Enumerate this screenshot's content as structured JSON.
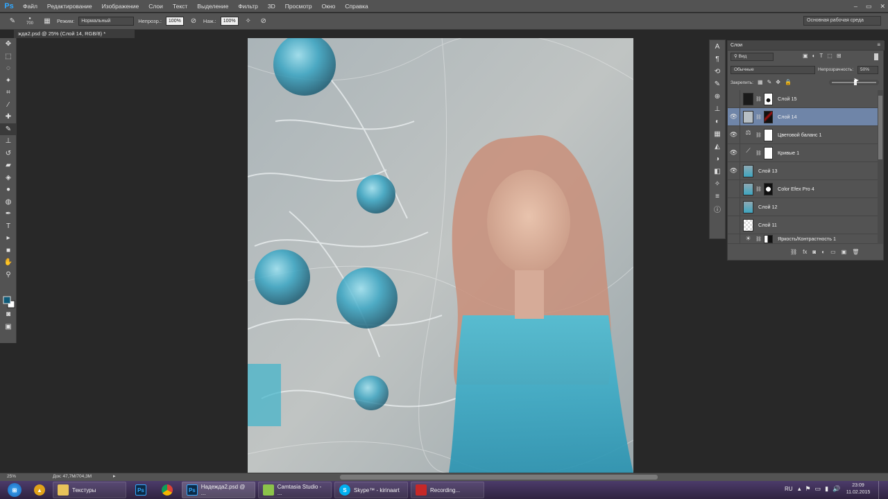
{
  "menubar": {
    "logo": "Ps",
    "items": [
      "Файл",
      "Редактирование",
      "Изображение",
      "Слои",
      "Текст",
      "Выделение",
      "Фильтр",
      "3D",
      "Просмотр",
      "Окно",
      "Справка"
    ],
    "win_controls": [
      "–",
      "▭",
      "✕"
    ]
  },
  "options": {
    "brush_size": "700",
    "mode_label": "Режим:",
    "mode_value": "Нормальный",
    "opacity_label": "Непрозр.:",
    "opacity_value": "100%",
    "flow_label": "Наж.:",
    "flow_value": "100%",
    "workspace": "Основная рабочая среда"
  },
  "document": {
    "tab_title": "жда2.psd @ 25% (Слой 14, RGB/8) *"
  },
  "layers_panel": {
    "tab": "Слои",
    "filter_kind": "Вид",
    "blend_mode": "Обычные",
    "opacity_label": "Непрозрачность:",
    "opacity_value": "50%",
    "lock_label": "Закрепить:",
    "layers": [
      {
        "name": "Слой 15",
        "visible": false,
        "has_mask": true,
        "selected": false
      },
      {
        "name": "Слой 14",
        "visible": true,
        "has_mask": true,
        "selected": true
      },
      {
        "name": "Цветовой баланс 1",
        "visible": true,
        "has_mask": true,
        "selected": false
      },
      {
        "name": "Кривые 1",
        "visible": true,
        "has_mask": true,
        "selected": false
      },
      {
        "name": "Слой 13",
        "visible": true,
        "has_mask": false,
        "selected": false
      },
      {
        "name": "Color Efex Pro 4",
        "visible": false,
        "has_mask": true,
        "selected": false
      },
      {
        "name": "Слой 12",
        "visible": false,
        "has_mask": false,
        "selected": false
      },
      {
        "name": "Слой 11",
        "visible": false,
        "has_mask": false,
        "selected": false
      },
      {
        "name": "Яркость/Контрастность 1",
        "visible": false,
        "has_mask": true,
        "selected": false
      }
    ]
  },
  "status": {
    "zoom": "25%",
    "doc_size": "Док: 47,7M/704,3M"
  },
  "taskbar": {
    "apps": [
      {
        "label": "Текстуры",
        "icon": "folder-icon"
      },
      {
        "label": "Надежда2.psd @ ...",
        "icon": "photoshop-icon"
      },
      {
        "label": "Camtasia Studio - ...",
        "icon": "camtasia-icon"
      },
      {
        "label": "Skype™ - kirinaart",
        "icon": "skype-icon"
      },
      {
        "label": "Recording...",
        "icon": "recording-icon"
      }
    ],
    "lang": "RU",
    "time": "23:09",
    "date": "11.02.2015"
  },
  "colors": {
    "panel_bg": "#535353",
    "selected_layer": "#6f85a8",
    "foreground_swatch": "#0f5a78",
    "background_swatch": "#ffffff"
  }
}
